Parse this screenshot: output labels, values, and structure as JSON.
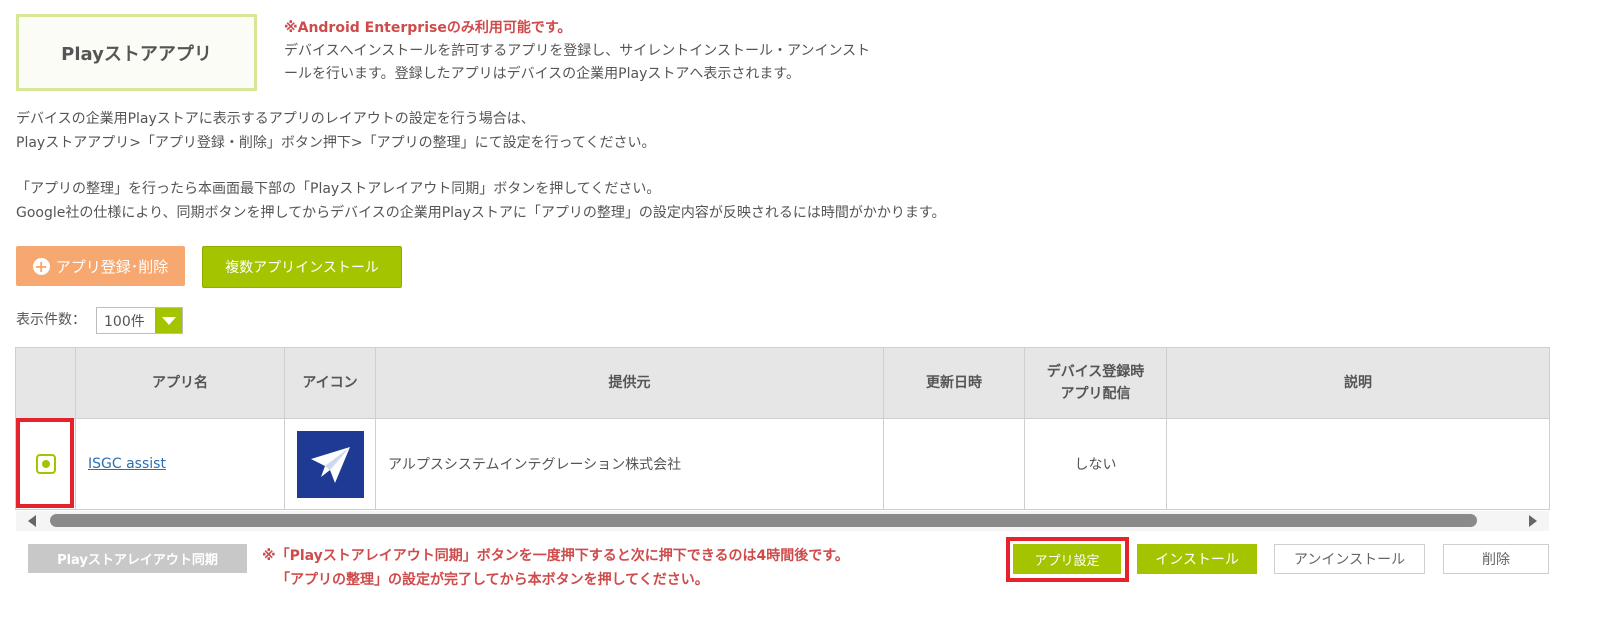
{
  "header": {
    "title": "Playストアアプリ",
    "notice_warning": "※Android Enterpriseのみ利用可能です。",
    "notice_line1": "デバイスへインストールを許可するアプリを登録し、サイレントインストール・アンインスト",
    "notice_line2": "ールを行います。登録したアプリはデバイスの企業用Playストアへ表示されます。"
  },
  "description": {
    "line1": "デバイスの企業用Playストアに表示するアプリのレイアウトの設定を行う場合は、",
    "line2": "Playストアアプリ>「アプリ登録・削除」ボタン押下>「アプリの整理」にて設定を行ってください。",
    "line3": "「アプリの整理」を行ったら本画面最下部の「Playストアレイアウト同期」ボタンを押してください。",
    "line4": "Google社の仕様により、同期ボタンを押してからデバイスの企業用Playストアに「アプリの整理」の設定内容が反映されるには時間がかかります。"
  },
  "actions": {
    "register_label": "アプリ登録･削除",
    "register_icon": "plus-circle-icon",
    "multi_install_label": "複数アプリインストール"
  },
  "pagination": {
    "count_label": "表示件数：",
    "count_value": "100件"
  },
  "table": {
    "columns": {
      "name": "アプリ名",
      "icon": "アイコン",
      "provider": "提供元",
      "updated": "更新日時",
      "deliver_line1": "デバイス登録時",
      "deliver_line2": "アプリ配信",
      "description": "説明"
    },
    "rows": [
      {
        "selected": true,
        "name": "ISGC assist",
        "icon": "isgc-assist-app-icon",
        "provider": "アルプスシステムインテグレーション株式会社",
        "updated": "",
        "deliver": "しない",
        "description": ""
      }
    ]
  },
  "footer": {
    "sync_label": "Playストアレイアウト同期",
    "sync_note_line1": "※「Playストアレイアウト同期」ボタンを一度押下すると次に押下できるのは4時間後です。",
    "sync_note_line2": "「アプリの整理」の設定が完了してから本ボタンを押してください。",
    "settings_label": "アプリ設定",
    "install_label": "インストール",
    "uninstall_label": "アンインストール",
    "delete_label": "削除"
  },
  "colors": {
    "accent_green": "#a4c400",
    "accent_orange": "#f6a870",
    "warning_red": "#cf4b4b",
    "highlight_red": "#e5232b"
  }
}
